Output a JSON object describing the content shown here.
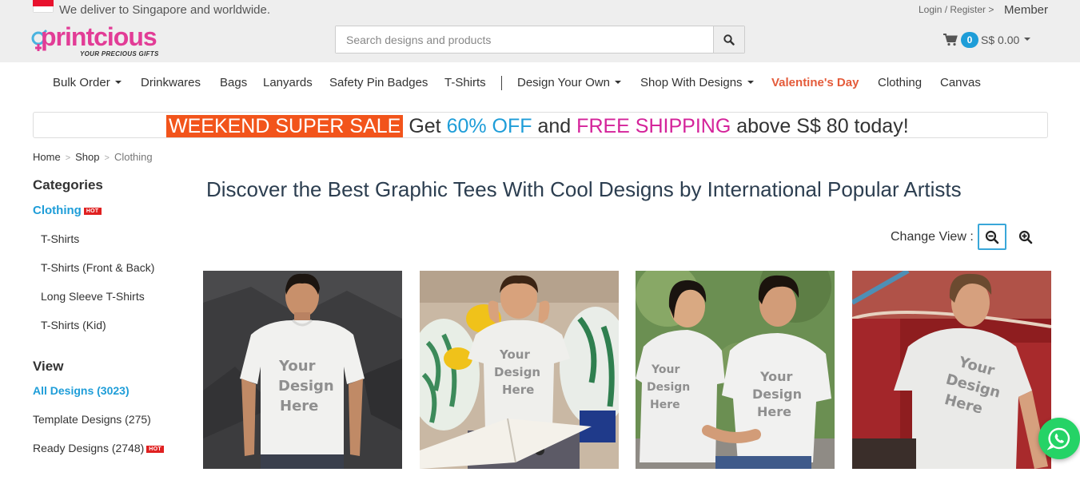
{
  "topbar": {
    "deliver_text": "We deliver to Singapore and worldwide.",
    "login_text": "Login / Register >",
    "member_text": "Member"
  },
  "header": {
    "logo_text": "printcious",
    "logo_tagline": "YOUR PRECIOUS GIFTS",
    "search_placeholder": "Search designs and products",
    "cart_count": "0",
    "cart_total": "S$ 0.00"
  },
  "nav": {
    "items": [
      {
        "label": "Bulk Order",
        "dropdown": true
      },
      {
        "label": "Drinkwares"
      },
      {
        "label": "Bags"
      },
      {
        "label": "Lanyards"
      },
      {
        "label": "Safety Pin Badges"
      },
      {
        "label": "T-Shirts"
      },
      {
        "label": "Design Your Own",
        "dropdown": true
      },
      {
        "label": "Shop With Designs",
        "dropdown": true
      },
      {
        "label": "Valentine's Day"
      },
      {
        "label": "Clothing"
      },
      {
        "label": "Canvas"
      }
    ]
  },
  "banner": {
    "sale": "WEEKEND SUPER SALE",
    "get": "Get",
    "off": "60% OFF",
    "and": "and",
    "free": "FREE SHIPPING",
    "rest": "above S$ 80 today!"
  },
  "breadcrumb": [
    "Home",
    "Shop",
    "Clothing"
  ],
  "sidebar": {
    "categories_heading": "Categories",
    "active_category": "Clothing",
    "hot_badge": "HOT",
    "subcategories": [
      "T-Shirts",
      "T-Shirts (Front & Back)",
      "Long Sleeve T-Shirts",
      "T-Shirts (Kid)"
    ],
    "view_heading": "View",
    "view_items": [
      {
        "label": "All Designs (3023)",
        "active": true
      },
      {
        "label": "Template Designs (275)"
      },
      {
        "label": "Ready Designs (2748)",
        "hot": true
      }
    ]
  },
  "main": {
    "headline": "Discover the Best Graphic Tees With Cool Designs by International Popular Artists",
    "change_view_label": "Change View :",
    "mockup_text": [
      "Your",
      "Design",
      "Here"
    ]
  },
  "colors": {
    "accent_blue": "#1e9dd8",
    "brand_pink": "#e23c96",
    "sale_orange": "#f2541b",
    "valentine_red": "#e45b3a",
    "whatsapp_green": "#25d366"
  }
}
